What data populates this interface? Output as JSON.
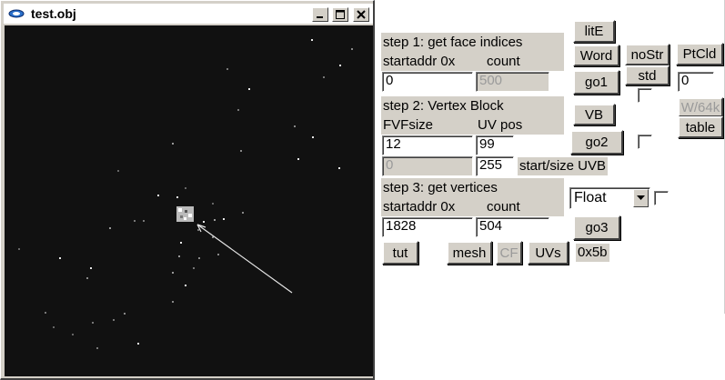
{
  "window": {
    "title": "test.obj",
    "icon": "app-icon",
    "controls": [
      "minimize-icon",
      "maximize-icon",
      "close-icon"
    ]
  },
  "panel": {
    "step1": {
      "heading": "step 1: get face indices",
      "col1_label": "startaddr 0x",
      "col2_label": "count",
      "startaddr": "0",
      "count": "500",
      "go_label": "go1"
    },
    "step2": {
      "heading": "step 2: Vertex Block",
      "col1_label": "FVFsize",
      "col2_label": "UV pos",
      "fvfsize": "12",
      "uvpos": "99",
      "uvb_start": "0",
      "uvb_size": "255",
      "uvb_label": "start/size UVB",
      "vb_label": "VB",
      "go_label": "go2"
    },
    "step3": {
      "heading": "step 3: get vertices",
      "col1_label": "startaddr 0x",
      "col2_label": "count",
      "startaddr": "1828",
      "count": "504",
      "format": "Float",
      "go_label": "go3"
    },
    "buttons": {
      "lite": "litE",
      "word": "Word",
      "nostr": "noStr",
      "std": "std",
      "ptcld": "PtCld",
      "ptcld_value": "0",
      "w64k": "W/64k",
      "table": "table",
      "tut": "tut",
      "mesh": "mesh",
      "cf": "CF",
      "uvs": "UVs"
    },
    "hex_readout": "0x5b"
  }
}
